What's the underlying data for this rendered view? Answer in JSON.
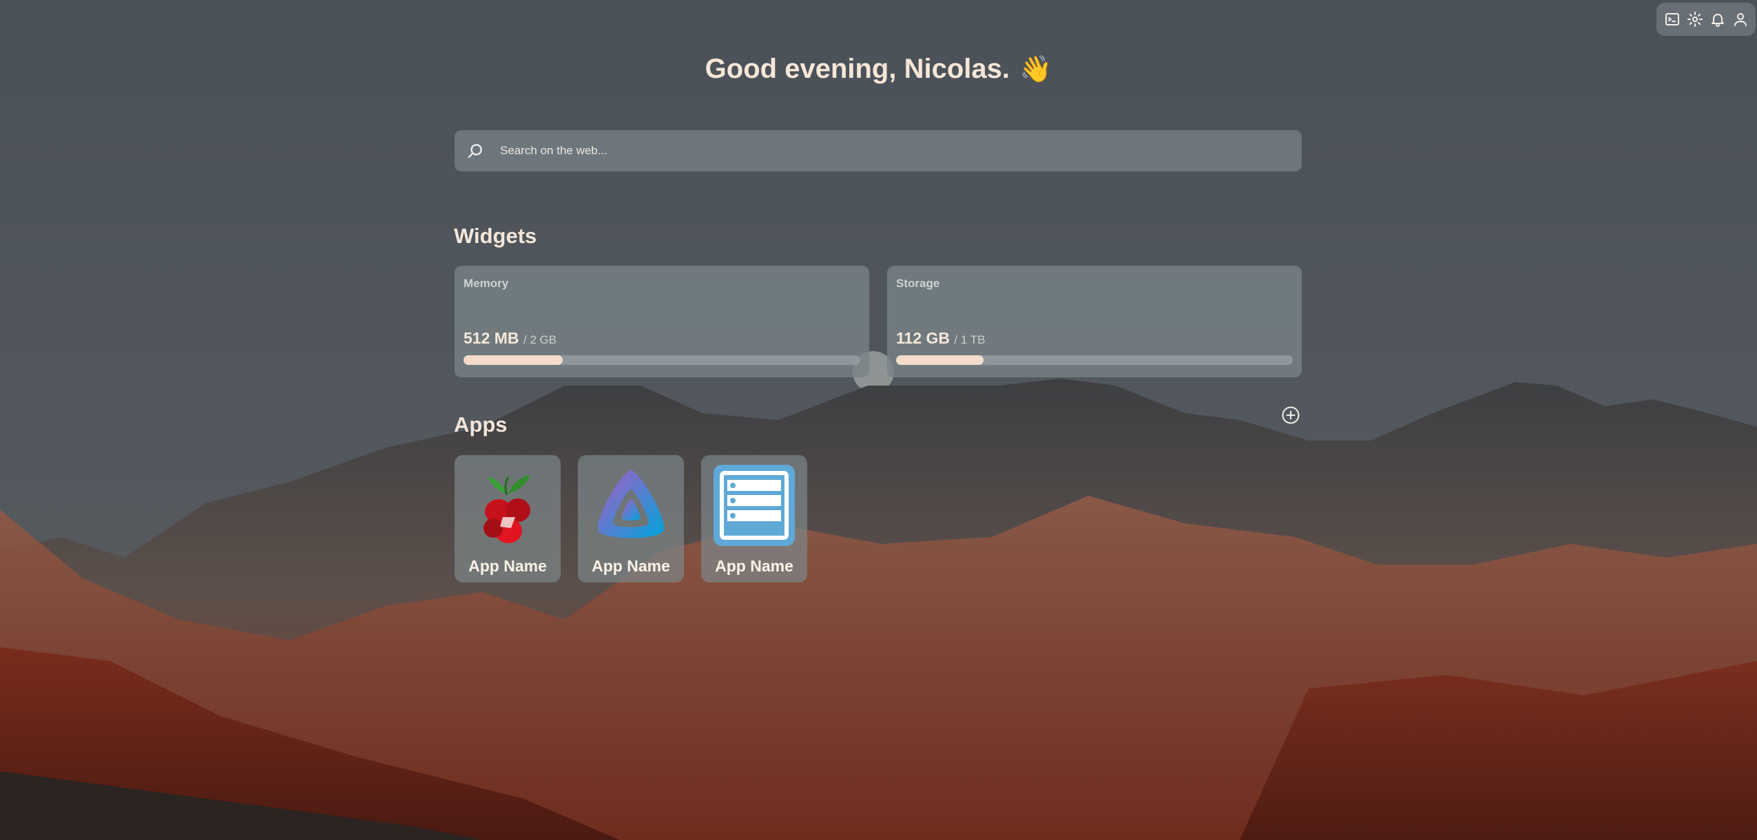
{
  "toolbar": {
    "icons": [
      "terminal-icon",
      "gear-icon",
      "bell-icon",
      "user-icon"
    ]
  },
  "greeting": {
    "text": "Good evening, Nicolas.",
    "emoji": "👋"
  },
  "search": {
    "placeholder": "Search on the web..."
  },
  "widgets": {
    "title": "Widgets",
    "items": [
      {
        "label": "Memory",
        "used": "512 MB",
        "total": "/ 2 GB",
        "fraction": 0.25
      },
      {
        "label": "Storage",
        "used": "112 GB",
        "total": "/ 1 TB",
        "fraction": 0.22
      }
    ]
  },
  "apps": {
    "title": "Apps",
    "items": [
      {
        "name": "App Name",
        "icon": "pihole-icon"
      },
      {
        "name": "App Name",
        "icon": "jellyfin-icon"
      },
      {
        "name": "App Name",
        "icon": "server-icon"
      }
    ]
  },
  "colors": {
    "accent_fill": "#f4dcc8",
    "card_bg": "#78848a",
    "text": "#f3e8dc"
  }
}
